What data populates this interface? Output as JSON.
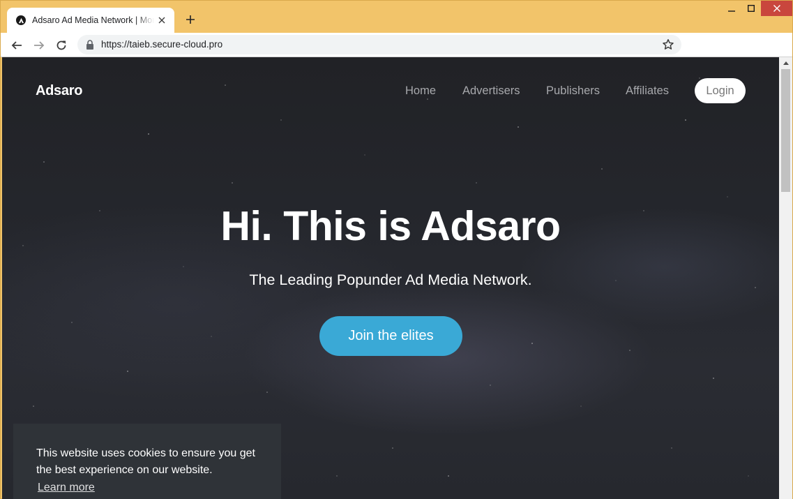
{
  "browser": {
    "tab_title": "Adsaro Ad Media Network | Monetize",
    "url": "https://taieb.secure-cloud.pro",
    "frame_color": "#f2c46a",
    "close_color": "#c9463d"
  },
  "site": {
    "brand": "Adsaro",
    "nav": {
      "home": "Home",
      "advertisers": "Advertisers",
      "publishers": "Publishers",
      "affiliates": "Affiliates",
      "login": "Login"
    },
    "hero": {
      "title": "Hi. This is Adsaro",
      "subtitle": "The Leading Popunder Ad Media Network.",
      "cta": "Join the elites",
      "cta_color": "#3aa9d6"
    },
    "cookie_banner": {
      "message": "This website uses cookies to ensure you get the best experience on our website.",
      "link": "Learn more"
    }
  },
  "icons": {
    "favicon": "adsaro-logo-icon",
    "close": "close-icon",
    "new_tab": "plus-icon",
    "back": "back-arrow-icon",
    "forward": "forward-arrow-icon",
    "reload": "reload-icon",
    "lock": "lock-icon",
    "bookmark": "star-icon",
    "minimize": "minimize-icon",
    "maximize": "maximize-icon"
  }
}
